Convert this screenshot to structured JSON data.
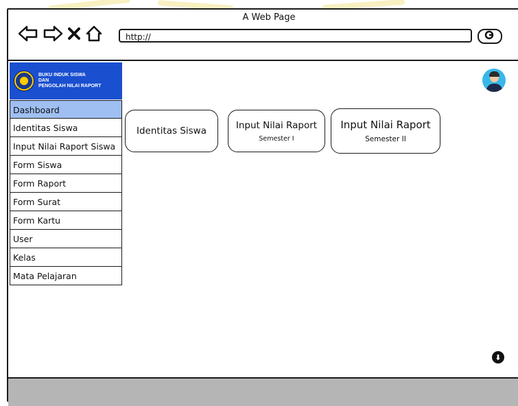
{
  "browser": {
    "title": "A Web Page",
    "url": "http://"
  },
  "brand": {
    "line1": "BUKU INDUK SISWA",
    "line2": "DAN",
    "line3": "PENGOLAH NILAI RAPORT"
  },
  "sidebar": {
    "items": [
      {
        "label": "Dashboard"
      },
      {
        "label": "Identitas Siswa"
      },
      {
        "label": "Input Nilai Raport Siswa"
      },
      {
        "label": "Form Siswa"
      },
      {
        "label": "Form Raport"
      },
      {
        "label": "Form Surat"
      },
      {
        "label": "Form Kartu"
      },
      {
        "label": "User"
      },
      {
        "label": "Kelas"
      },
      {
        "label": "Mata Pelajaran"
      }
    ],
    "active_index": 0
  },
  "cards": [
    {
      "title": "Identitas Siswa",
      "subtitle": ""
    },
    {
      "title": "Input Nilai Raport",
      "subtitle": "Semester I"
    },
    {
      "title": "Input Nilai Raport",
      "subtitle": "Semester II"
    }
  ],
  "icons": {
    "back": "back-arrow-icon",
    "forward": "forward-arrow-icon",
    "stop": "close-icon",
    "home": "home-icon",
    "search": "search-icon",
    "download": "download-icon"
  }
}
